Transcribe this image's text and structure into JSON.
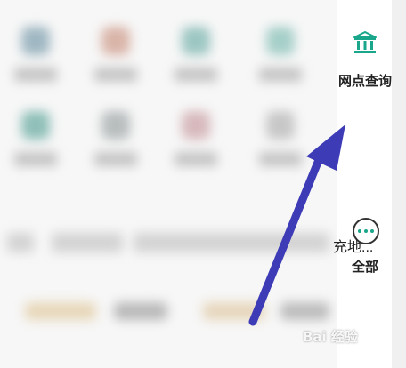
{
  "sidebar": {
    "items": [
      {
        "label": "网点查询",
        "icon": "bank-building-icon"
      },
      {
        "label": "全部",
        "icon": "more-dots-icon"
      }
    ],
    "icon_color": "#1aa68a"
  },
  "truncated_text": "充地...",
  "arrow_color": "#3e3bb6",
  "watermark": "Bai 经验"
}
